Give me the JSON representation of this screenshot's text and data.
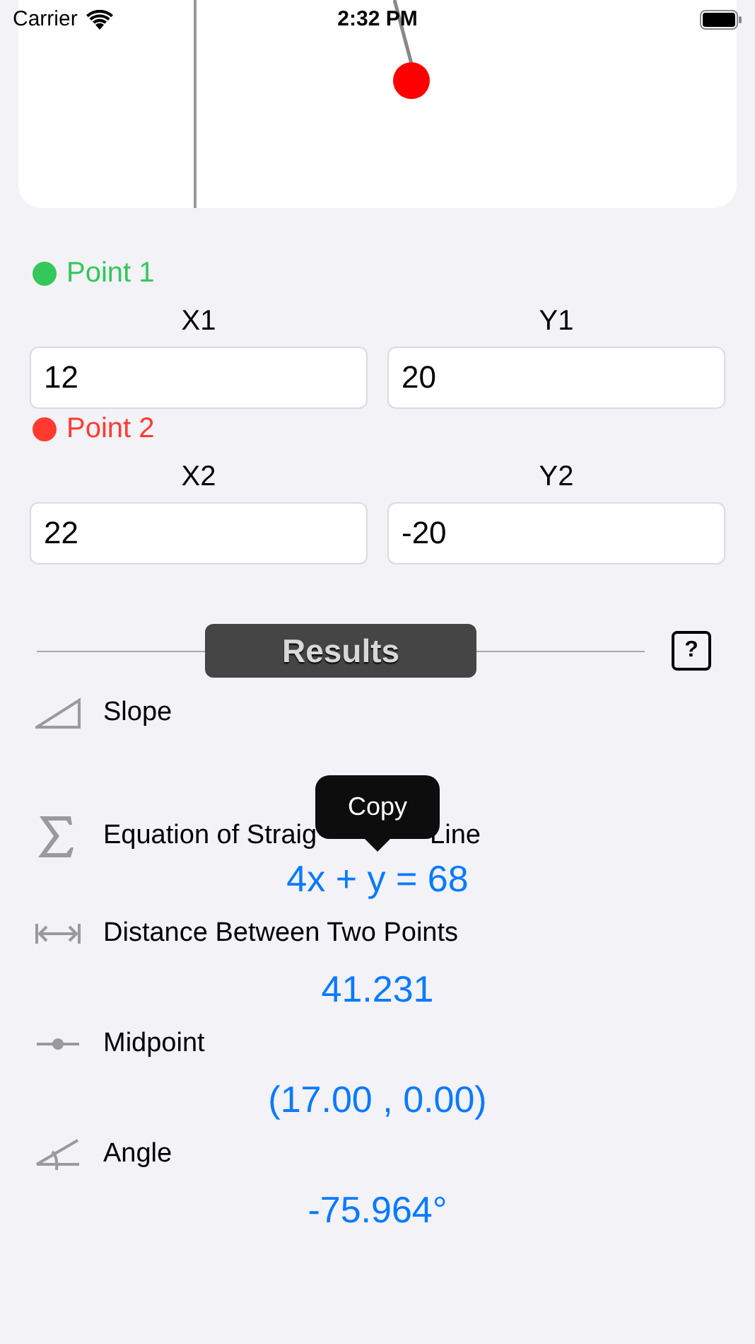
{
  "status_bar": {
    "carrier": "Carrier",
    "time": "2:32 PM"
  },
  "points": [
    {
      "label": "Point 1",
      "color": "#34c759",
      "fields": [
        {
          "label": "X1",
          "value": "12"
        },
        {
          "label": "Y1",
          "value": "20"
        }
      ]
    },
    {
      "label": "Point 2",
      "color": "#ff3b30",
      "fields": [
        {
          "label": "X2",
          "value": "22"
        },
        {
          "label": "Y2",
          "value": "-20"
        }
      ]
    }
  ],
  "results_header": {
    "title": "Results",
    "help": "?"
  },
  "results": [
    {
      "kind": "slope",
      "label": "Slope"
    },
    {
      "kind": "equation",
      "label": "Equation of Straig",
      "label_tail": "Line",
      "value": "4x + y = 68"
    },
    {
      "kind": "distance",
      "label": "Distance Between Two Points",
      "value": "41.231"
    },
    {
      "kind": "midpoint",
      "label": "Midpoint",
      "value": "(17.00 , 0.00)"
    },
    {
      "kind": "angle",
      "label": "Angle",
      "value": "-75.964°"
    }
  ],
  "tooltip": {
    "label": "Copy"
  }
}
